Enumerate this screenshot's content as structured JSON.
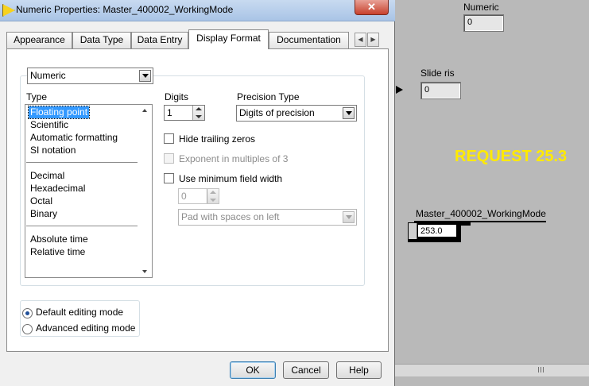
{
  "window": {
    "title": "Numeric Properties: Master_400002_WorkingMode",
    "close_glyph": "✕"
  },
  "tabs": [
    {
      "label": "Appearance"
    },
    {
      "label": "Data Type"
    },
    {
      "label": "Data Entry"
    },
    {
      "label": "Display Format",
      "active": true
    },
    {
      "label": "Documentation"
    }
  ],
  "display_format": {
    "format_select": "Numeric",
    "type_label": "Type",
    "type_groups": [
      [
        "Floating point",
        "Scientific",
        "Automatic formatting",
        "SI notation"
      ],
      [
        "Decimal",
        "Hexadecimal",
        "Octal",
        "Binary"
      ],
      [
        "Absolute time",
        "Relative time"
      ]
    ],
    "selected_type": "Floating point",
    "digits_label": "Digits",
    "digits_value": "1",
    "precision_type_label": "Precision Type",
    "precision_type_value": "Digits of precision",
    "hide_trailing_zeros": {
      "label": "Hide trailing zeros",
      "checked": false
    },
    "exponent_multiples": {
      "label": "Exponent in multiples of 3",
      "checked": false,
      "enabled": false
    },
    "min_field_width": {
      "label": "Use minimum field width",
      "checked": false
    },
    "min_width_value": "0",
    "padding_value": "Pad with spaces on left"
  },
  "editing_mode": {
    "default_label": "Default editing mode",
    "advanced_label": "Advanced editing mode",
    "selected": "default"
  },
  "buttons": {
    "ok": "OK",
    "cancel": "Cancel",
    "help": "Help"
  },
  "front_panel": {
    "numeric_label": "Numeric",
    "numeric_value": "0",
    "slide_label": "Slide ris",
    "slide_value": "0",
    "request_text": "REQUEST 25.3",
    "working_mode_label": "Master_400002_WorkingMode",
    "working_mode_value": "253.0"
  },
  "colors": {
    "request_text": "#ffea00",
    "selection": "#3399ff",
    "panel_background": "#b9b9b9"
  }
}
